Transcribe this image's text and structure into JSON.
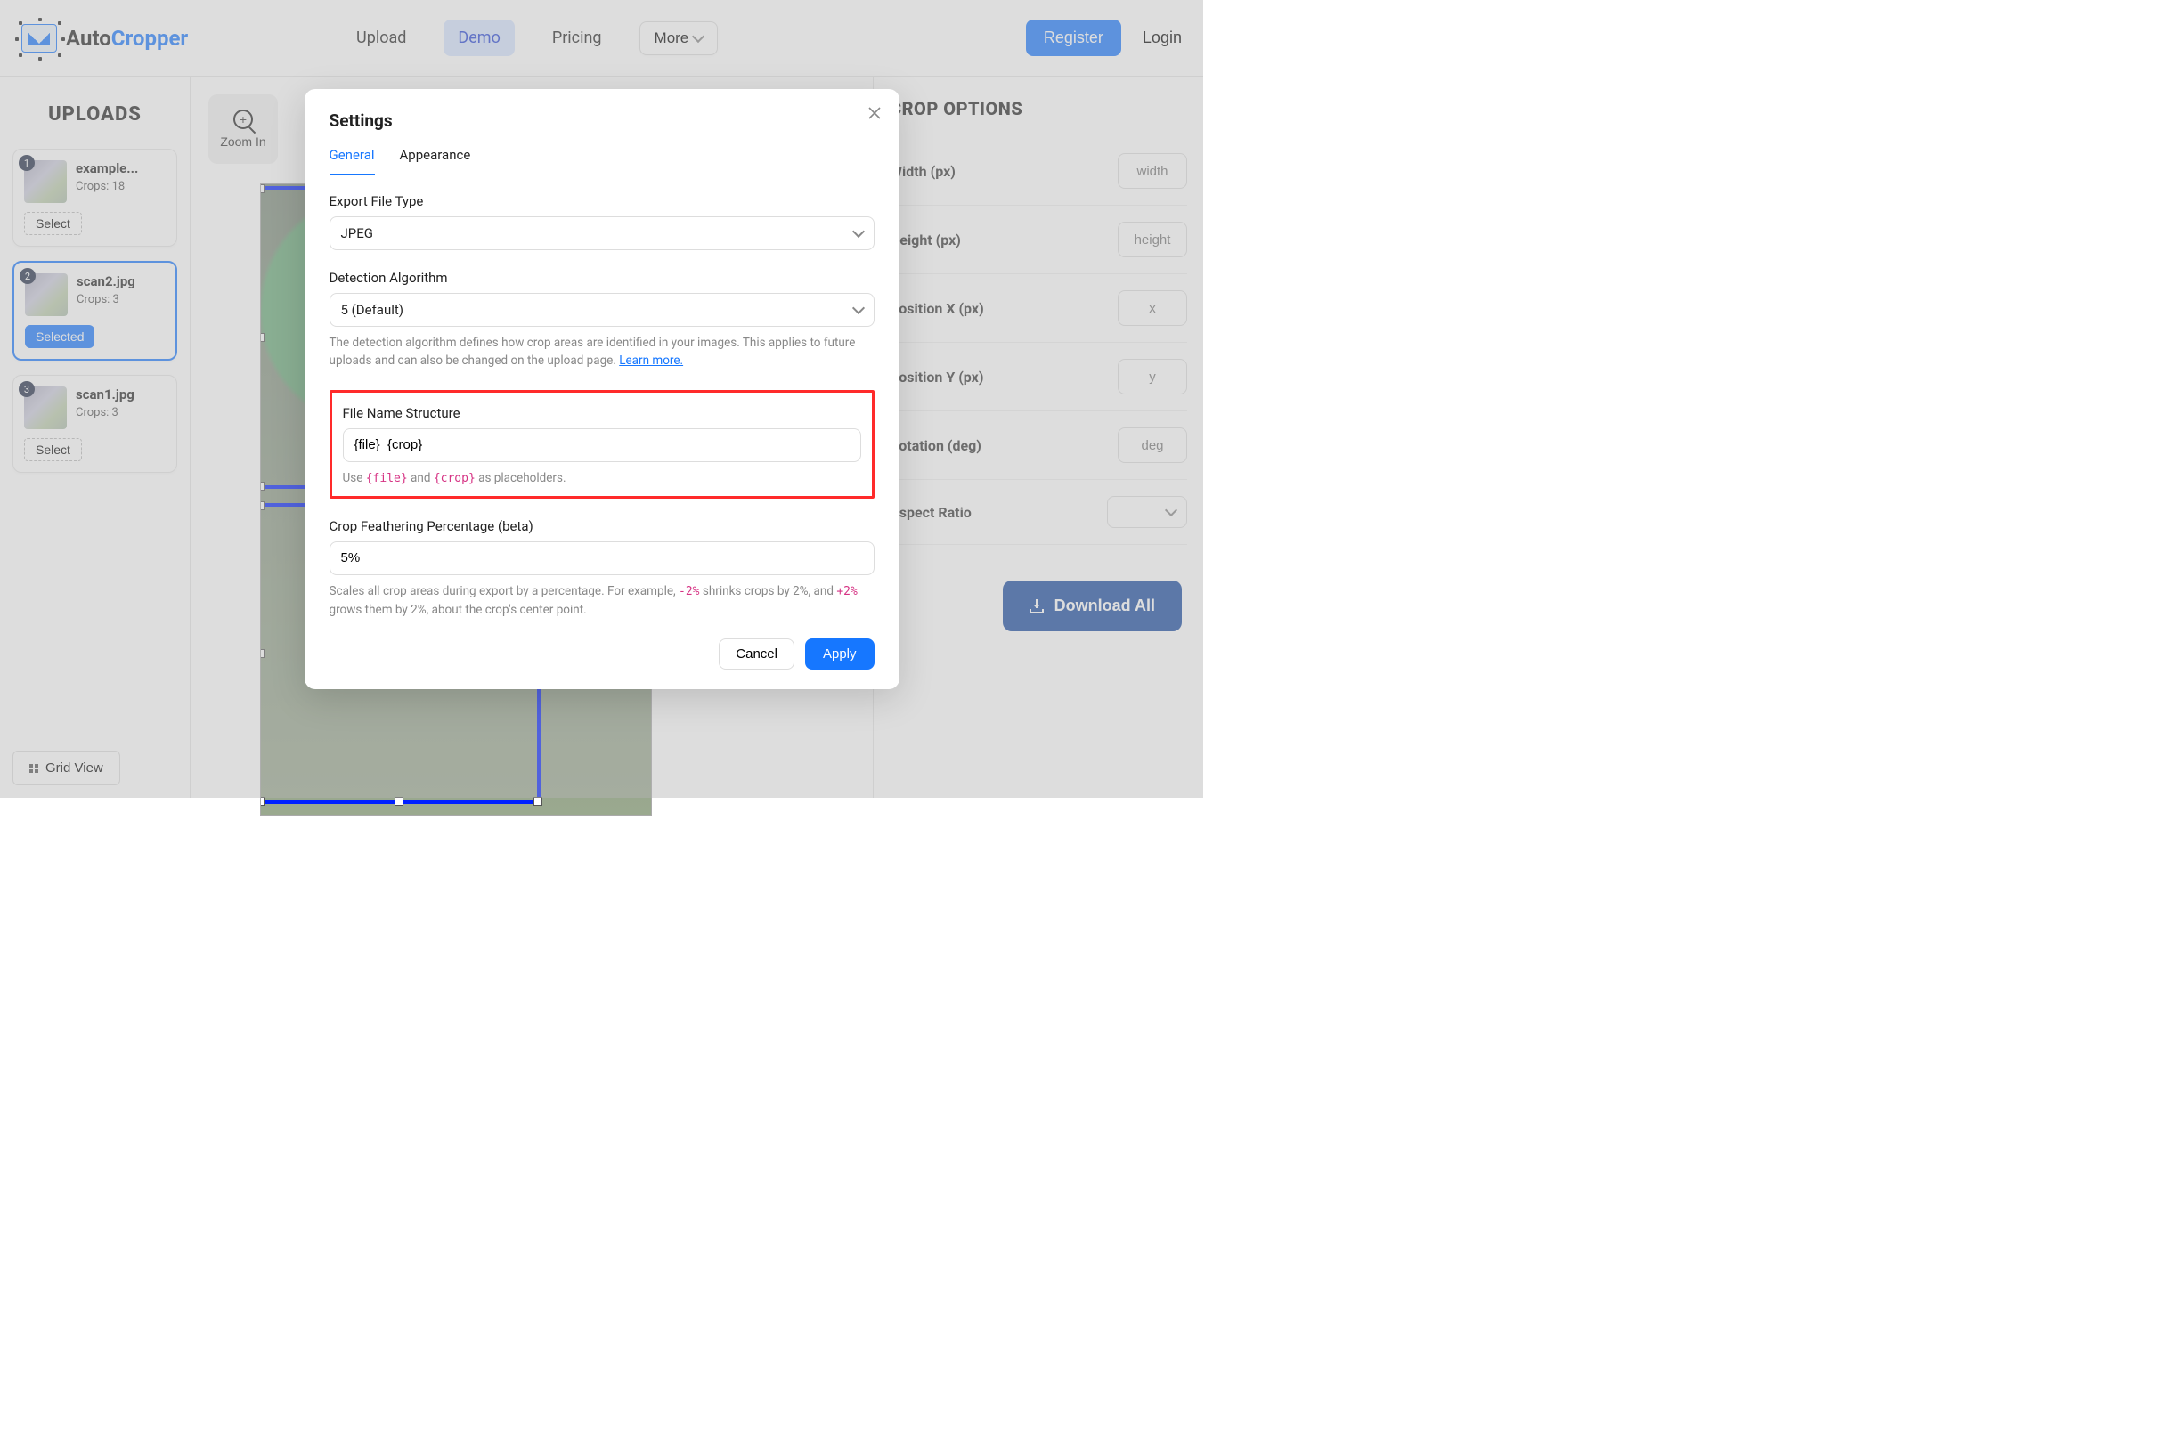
{
  "brand": {
    "prefix": "Auto",
    "suffix": "Cropper"
  },
  "nav": {
    "upload": "Upload",
    "demo": "Demo",
    "pricing": "Pricing",
    "more": "More",
    "register": "Register",
    "login": "Login"
  },
  "sidebar": {
    "title": "UPLOADS",
    "grid_view": "Grid View",
    "select_label": "Select",
    "selected_label": "Selected",
    "items": [
      {
        "index": "1",
        "name": "example...",
        "crops": "Crops: 18",
        "selected": false
      },
      {
        "index": "2",
        "name": "scan2.jpg",
        "crops": "Crops: 3",
        "selected": true
      },
      {
        "index": "3",
        "name": "scan1.jpg",
        "crops": "Crops: 3",
        "selected": false
      }
    ]
  },
  "canvas": {
    "zoom_in": "Zoom In"
  },
  "crop_panel": {
    "title": "CROP OPTIONS",
    "fields": {
      "width": {
        "label": "Width (px)",
        "placeholder": "width"
      },
      "height": {
        "label": "Height (px)",
        "placeholder": "height"
      },
      "posx": {
        "label": "Position X (px)",
        "placeholder": "x"
      },
      "posy": {
        "label": "Position Y (px)",
        "placeholder": "y"
      },
      "rot": {
        "label": "Rotation (deg)",
        "placeholder": "deg"
      },
      "aspect": {
        "label": "Aspect Ratio"
      }
    },
    "download": "Download All"
  },
  "modal": {
    "title": "Settings",
    "tabs": {
      "general": "General",
      "appearance": "Appearance"
    },
    "export_type": {
      "label": "Export File Type",
      "value": "JPEG"
    },
    "detection": {
      "label": "Detection Algorithm",
      "value": "5 (Default)",
      "help_pre": "The detection algorithm defines how crop areas are identified in your images. This applies to future uploads and can also be changed on the upload page. ",
      "learn_more": "Learn more."
    },
    "filename": {
      "label": "File Name Structure",
      "value": "{file}_{crop}",
      "help_pre": "Use ",
      "ph_file": "{file}",
      "help_mid": " and ",
      "ph_crop": "{crop}",
      "help_post": " as placeholders."
    },
    "feather": {
      "label": "Crop Feathering Percentage (beta)",
      "value": "5%",
      "help_pre": "Scales all crop areas during export by a percentage. For example, ",
      "ex_neg": "-2%",
      "help_mid": " shrinks crops by 2%, and ",
      "ex_pos": "+2%",
      "help_post": " grows them by 2%, about the crop's center point."
    },
    "buttons": {
      "cancel": "Cancel",
      "apply": "Apply"
    }
  }
}
